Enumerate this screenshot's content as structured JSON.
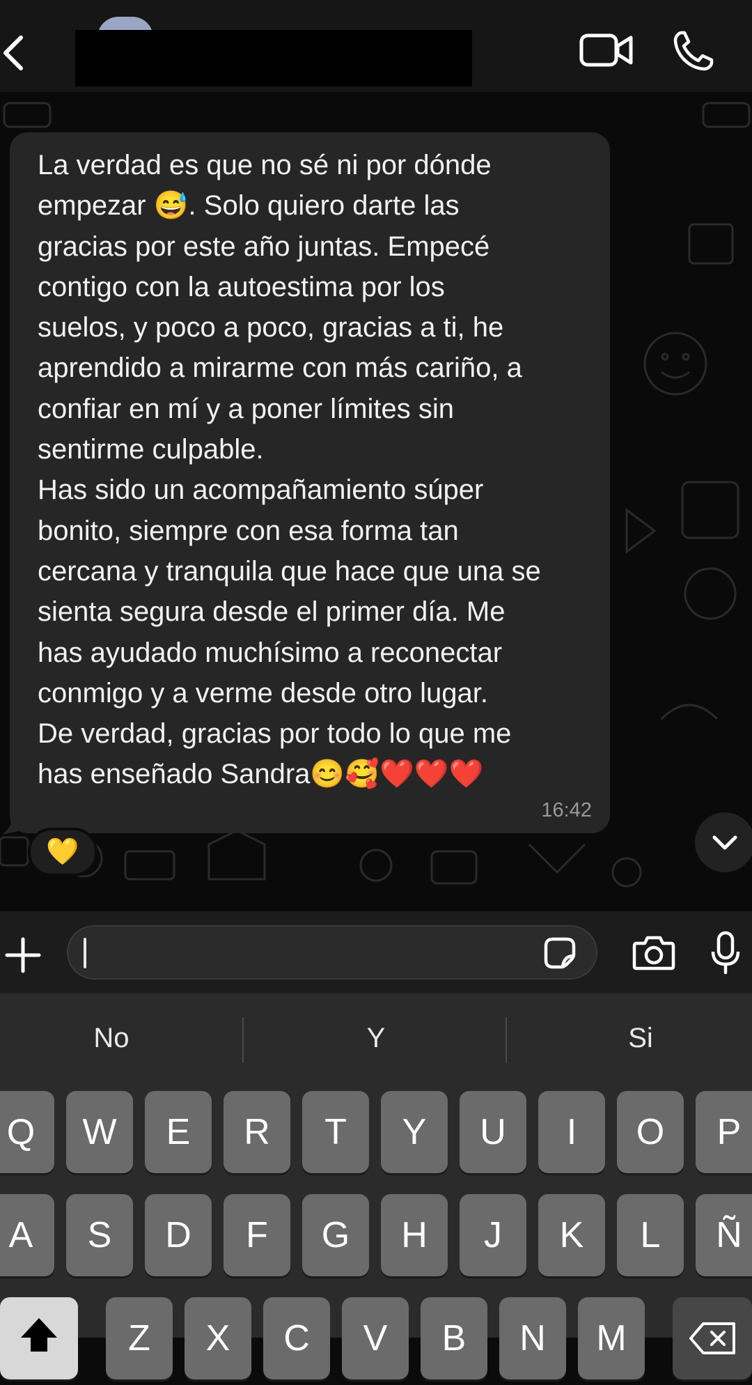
{
  "header": {
    "back_icon": "chevron-left-icon",
    "contact_name": "",
    "video_icon": "video-camera-icon",
    "call_icon": "phone-icon"
  },
  "message": {
    "text": "La verdad es que no sé ni por dónde\nempezar 😅. Solo quiero darte las\ngracias por este año juntas. Empecé\ncontigo con la autoestima por los\nsuelos, y poco a poco, gracias a ti, he\naprendido a mirarme con más cariño, a\nconfiar en mí y a poner límites sin\nsentirme culpable.\nHas sido un acompañamiento súper\nbonito, siempre con esa forma tan\ncercana y tranquila que hace que una se\nsienta segura desde el primer día. Me\nhas ayudado muchísimo a reconectar\nconmigo y a verme desde otro lugar.\nDe verdad, gracias por todo lo que me\nhas enseñado Sandra😊🥰❤️❤️❤️",
    "time": "16:42",
    "reaction": "💛"
  },
  "input_bar": {
    "plus_icon": "plus-icon",
    "placeholder": "",
    "value": "",
    "sticker_icon": "sticker-icon",
    "camera_icon": "camera-icon",
    "mic_icon": "microphone-icon"
  },
  "keyboard": {
    "suggestions": [
      "No",
      "Y",
      "Si"
    ],
    "row1": [
      "Q",
      "W",
      "E",
      "R",
      "T",
      "Y",
      "U",
      "I",
      "O",
      "P"
    ],
    "row2": [
      "A",
      "S",
      "D",
      "F",
      "G",
      "H",
      "J",
      "K",
      "L",
      "Ñ"
    ],
    "row3": [
      "Z",
      "X",
      "C",
      "V",
      "B",
      "N",
      "M"
    ]
  },
  "colors": {
    "background": "#0b0b0b",
    "bubble": "#262626",
    "header": "#161616",
    "keyboard": "#2b2b2b",
    "key": "#6b6b6b"
  }
}
